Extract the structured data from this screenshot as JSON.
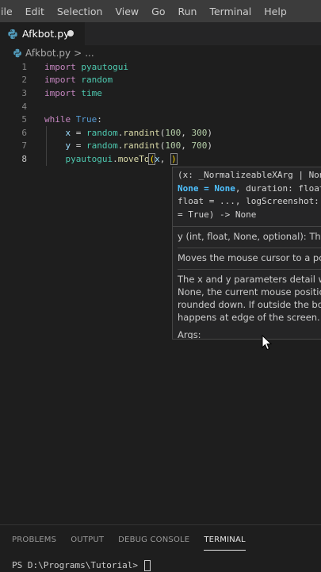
{
  "menu": [
    "File",
    "Edit",
    "Selection",
    "View",
    "Go",
    "Run",
    "Terminal",
    "Help"
  ],
  "menu_visible": [
    "ile",
    "Edit",
    "Selection",
    "View",
    "Go",
    "Run",
    "Terminal",
    "Help"
  ],
  "tab": {
    "filename": "Afkbot.py"
  },
  "breadcrumb": {
    "file": "Afkbot.py",
    "sep": ">",
    "rest": "..."
  },
  "lines": [
    {
      "n": "1",
      "tokens": [
        [
          "kw",
          "import"
        ],
        [
          "op",
          " "
        ],
        [
          "mod",
          "pyautogui"
        ]
      ]
    },
    {
      "n": "2",
      "tokens": [
        [
          "kw",
          "import"
        ],
        [
          "op",
          " "
        ],
        [
          "mod",
          "random"
        ]
      ]
    },
    {
      "n": "3",
      "tokens": [
        [
          "kw",
          "import"
        ],
        [
          "op",
          " "
        ],
        [
          "mod",
          "time"
        ]
      ]
    },
    {
      "n": "4",
      "tokens": []
    },
    {
      "n": "5",
      "tokens": [
        [
          "kw",
          "while"
        ],
        [
          "op",
          " "
        ],
        [
          "kw2",
          "True"
        ],
        [
          "op",
          ":"
        ]
      ]
    },
    {
      "n": "6",
      "tokens": [
        [
          "op",
          "    "
        ],
        [
          "var",
          "x"
        ],
        [
          "op",
          " = "
        ],
        [
          "mod",
          "random"
        ],
        [
          "op",
          "."
        ],
        [
          "fn",
          "randint"
        ],
        [
          "op",
          "("
        ],
        [
          "num",
          "100"
        ],
        [
          "op",
          ", "
        ],
        [
          "num",
          "300"
        ],
        [
          "op",
          ")"
        ]
      ]
    },
    {
      "n": "7",
      "tokens": [
        [
          "op",
          "    "
        ],
        [
          "var",
          "y"
        ],
        [
          "op",
          " = "
        ],
        [
          "mod",
          "random"
        ],
        [
          "op",
          "."
        ],
        [
          "fn",
          "randint"
        ],
        [
          "op",
          "("
        ],
        [
          "num",
          "100"
        ],
        [
          "op",
          ", "
        ],
        [
          "num",
          "700"
        ],
        [
          "op",
          ")"
        ]
      ]
    },
    {
      "n": "8",
      "tokens": [
        [
          "op",
          "    "
        ],
        [
          "mod",
          "pyautogui"
        ],
        [
          "op",
          "."
        ],
        [
          "fn",
          "moveTo"
        ],
        [
          "bracket",
          "("
        ],
        [
          "var",
          "x"
        ],
        [
          "op",
          ", "
        ],
        [
          "cursor",
          ""
        ],
        [
          "bracket",
          ")"
        ]
      ]
    }
  ],
  "signature": {
    "line1": "(x: _NormalizeableXArg | None",
    "line2_hl": "None = None",
    "line2_rest": ", duration: float",
    "line3": "float = ..., logScreenshot:",
    "line4": "= True) -> None"
  },
  "doc": {
    "param": "y (int, float, None, optional): The y",
    "summary": "Moves the mouse cursor to a point",
    "detail1": "The x and y parameters detail whe",
    "detail2": "None, the current mouse position",
    "detail3": "rounded down. If outside the bou",
    "detail4": "happens at edge of the screen.",
    "args": "Args:"
  },
  "panel": {
    "tabs": [
      "PROBLEMS",
      "OUTPUT",
      "DEBUG CONSOLE",
      "TERMINAL"
    ],
    "prompt": "PS D:\\Programs\\Tutorial> "
  },
  "colors": {
    "editor_bg": "#1e1e1e",
    "menubar_bg": "#3c3c3c",
    "keyword": "#c586c0",
    "module": "#4ec9b0"
  }
}
